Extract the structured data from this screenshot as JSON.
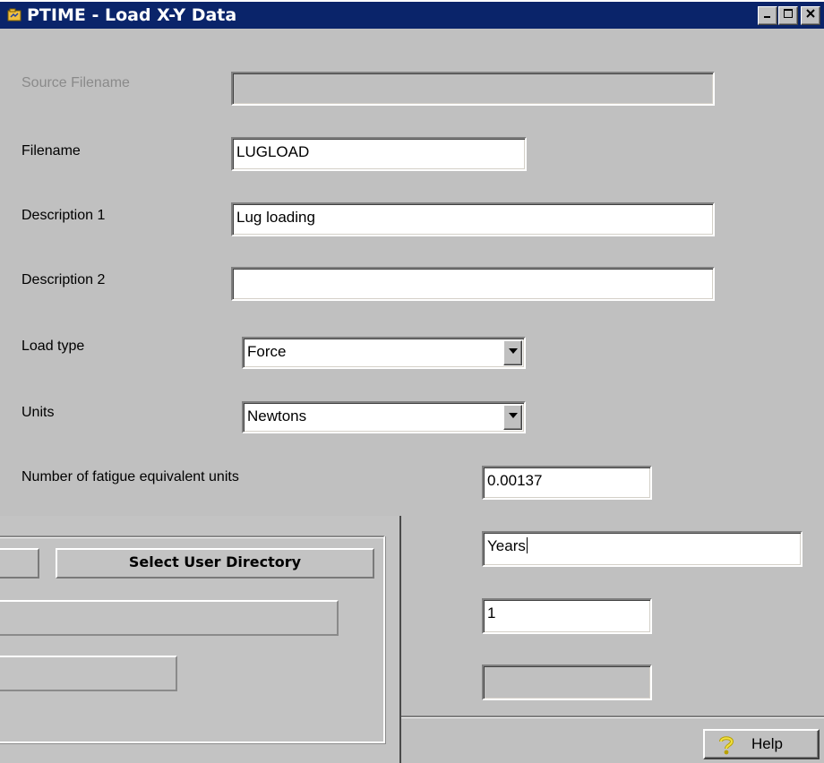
{
  "window": {
    "title": "PTIME - Load X-Y Data",
    "controls": [
      "minimize-icon",
      "maximize-icon",
      "close-icon"
    ],
    "titlebar_color": "#0a246a"
  },
  "form": {
    "source_filename": {
      "label": "Source Filename",
      "value": ""
    },
    "filename": {
      "label": "Filename",
      "value": "LUGLOAD"
    },
    "description1": {
      "label": "Description 1",
      "value": "Lug loading"
    },
    "description2": {
      "label": "Description 2",
      "value": ""
    },
    "load_type": {
      "label": "Load type",
      "value": "Force"
    },
    "units": {
      "label": "Units",
      "value": "Newtons"
    },
    "fatigue_units": {
      "label": "Number of fatigue equivalent units",
      "value": "0.00137"
    },
    "period_unit": {
      "value": "Years"
    },
    "count": {
      "value": "1"
    },
    "extra": {
      "value": ""
    }
  },
  "overlay": {
    "select_user_directory": "Select User Directory"
  },
  "help": {
    "label": "Help",
    "icon": "help-question-icon"
  }
}
